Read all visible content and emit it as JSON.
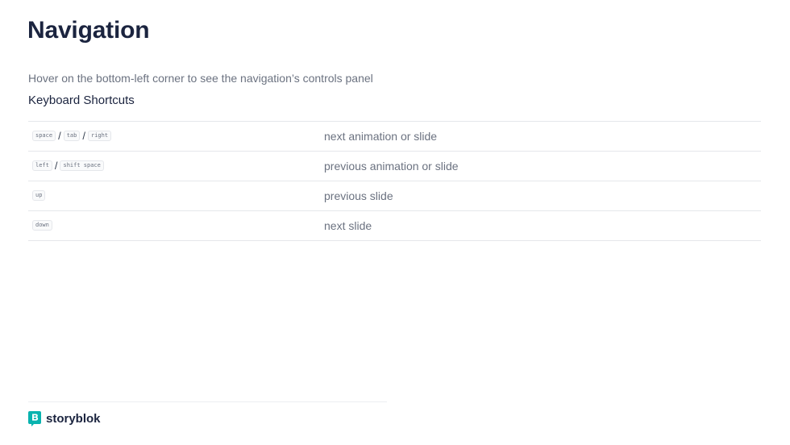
{
  "slide": {
    "title": "Navigation",
    "hint": "Hover on the bottom-left corner to see the navigation’s controls panel",
    "subtitle": "Keyboard Shortcuts"
  },
  "shortcuts": [
    {
      "keys": [
        "space",
        "tab",
        "right"
      ],
      "description": "next animation or slide"
    },
    {
      "keys": [
        "left",
        "shift space"
      ],
      "description": "previous animation or slide"
    },
    {
      "keys": [
        "up"
      ],
      "description": "previous slide"
    },
    {
      "keys": [
        "down"
      ],
      "description": "next slide"
    }
  ],
  "footer": {
    "brand": "storyblok",
    "brand_color": "#09b3af"
  }
}
